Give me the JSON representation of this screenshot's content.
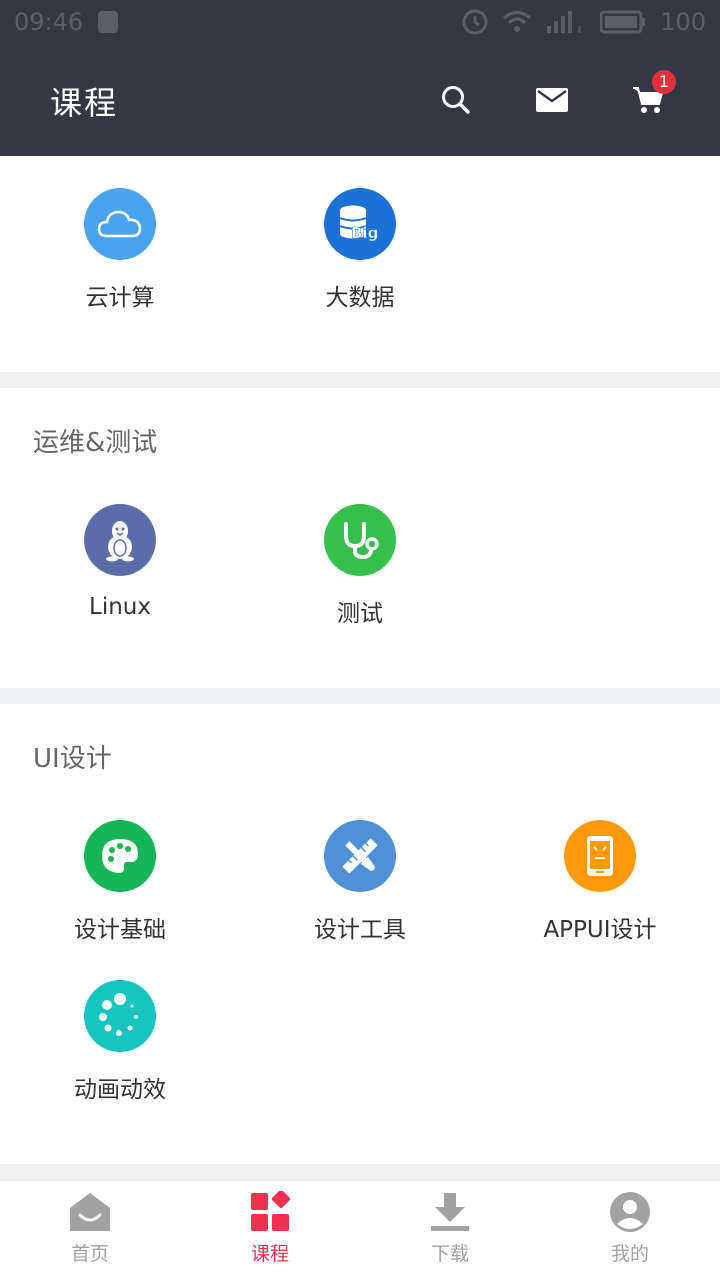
{
  "status_bar": {
    "time": "09:46",
    "battery": "100"
  },
  "header": {
    "title": "课程",
    "cart_count": "1"
  },
  "sections": [
    {
      "title": "",
      "items": [
        {
          "label": "云计算",
          "icon": "cloud-icon",
          "color": "#4aa3ef"
        },
        {
          "label": "大数据",
          "icon": "big-data-icon",
          "color": "#1a72d6"
        }
      ]
    },
    {
      "title": "运维&测试",
      "items": [
        {
          "label": "Linux",
          "icon": "linux-penguin-icon",
          "color": "#5b6ca8"
        },
        {
          "label": "测试",
          "icon": "stethoscope-icon",
          "color": "#35c04c"
        }
      ]
    },
    {
      "title": "UI设计",
      "items": [
        {
          "label": "设计基础",
          "icon": "palette-icon",
          "color": "#14b655"
        },
        {
          "label": "设计工具",
          "icon": "ruler-brush-icon",
          "color": "#4f91d9"
        },
        {
          "label": "APPUI设计",
          "icon": "phone-icon",
          "color": "#fd9a0b"
        },
        {
          "label": "动画动效",
          "icon": "loading-dots-icon",
          "color": "#14c5c0"
        }
      ]
    }
  ],
  "bottom_nav": [
    {
      "label": "首页",
      "icon": "home-icon",
      "active": false
    },
    {
      "label": "课程",
      "icon": "course-grid-icon",
      "active": true
    },
    {
      "label": "下载",
      "icon": "download-icon",
      "active": false
    },
    {
      "label": "我的",
      "icon": "profile-icon",
      "active": false
    }
  ],
  "colors": {
    "header_bg": "#343845",
    "active": "#f03050",
    "inactive": "#a2a2a2"
  }
}
